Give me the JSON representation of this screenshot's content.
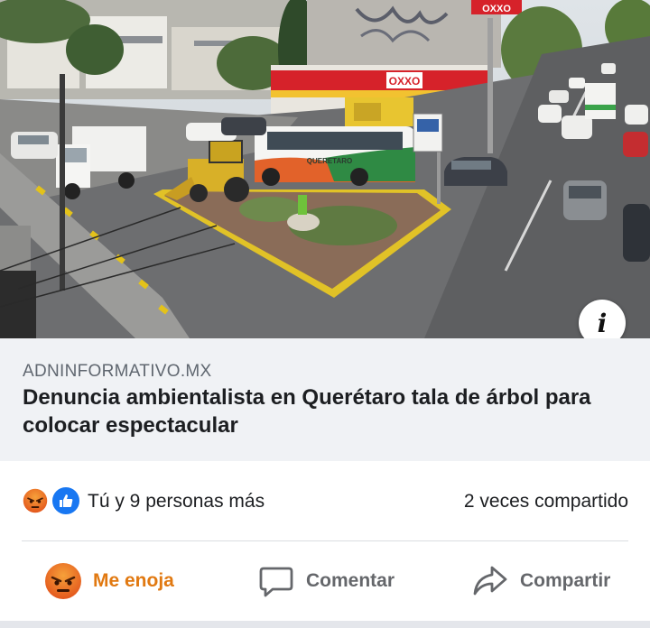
{
  "post_image": {
    "icon": "info-icon",
    "scene": {
      "store_sign": "OXXO",
      "rooftop_sign": "OXXO",
      "bus_text": "QUERETARO"
    }
  },
  "link_preview": {
    "domain": "ADNINFORMATIVO.MX",
    "title": "Denuncia ambientalista en Querétaro tala de árbol para colocar espectacular"
  },
  "reactions": {
    "icons": [
      "angry-reaction-icon",
      "like-reaction-icon"
    ],
    "summary": "Tú y 9 personas más",
    "shares": "2 veces compartido"
  },
  "actions": {
    "react": {
      "label": "Me enoja",
      "icon": "angry-reaction-icon",
      "color": "#e17911"
    },
    "comment": {
      "label": "Comentar",
      "icon": "comment-icon"
    },
    "share": {
      "label": "Compartir",
      "icon": "share-icon"
    }
  },
  "colors": {
    "card_background": "#f0f2f5",
    "domain_text": "#606770",
    "action_text": "#65676b",
    "like_blue": "#1877f2",
    "angry_orange": "#e8641b"
  }
}
